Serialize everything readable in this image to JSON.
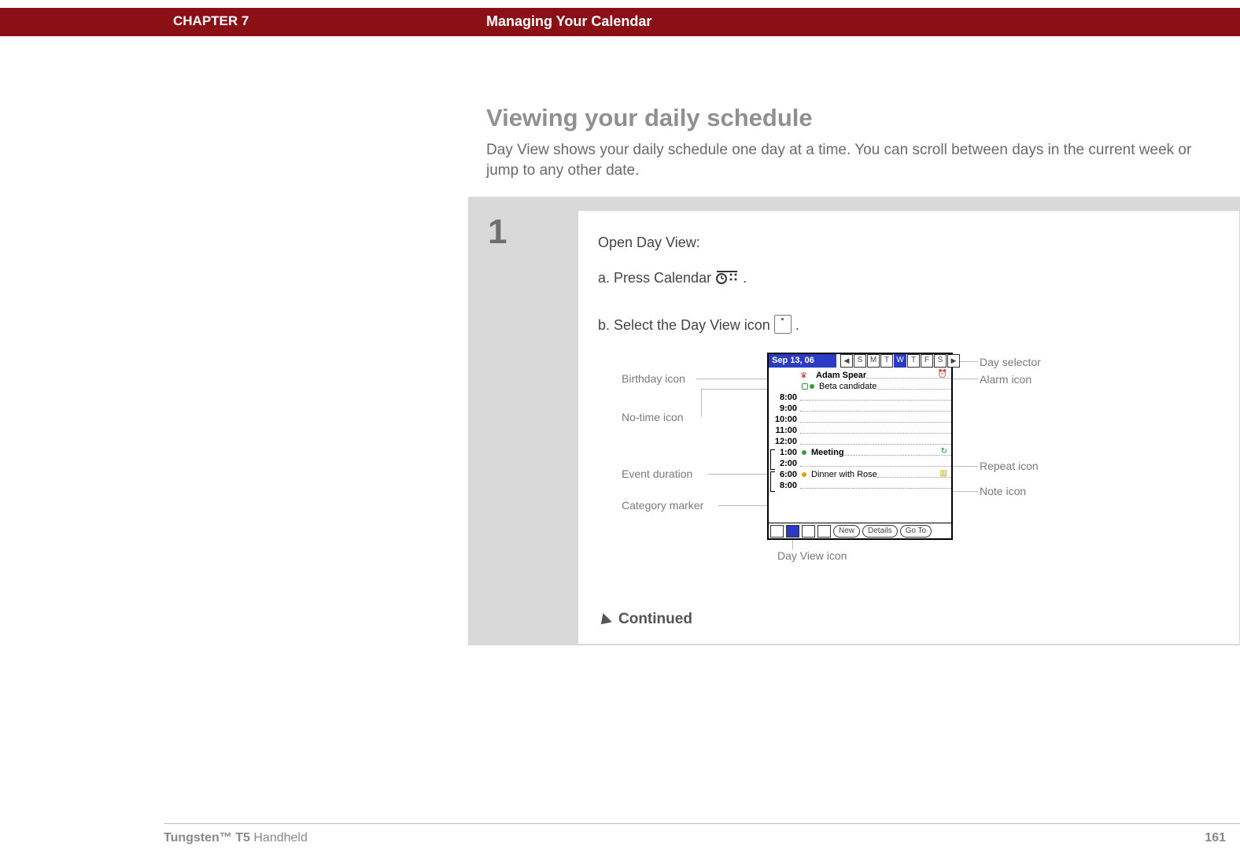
{
  "header": {
    "chapter": "CHAPTER 7",
    "title": "Managing Your Calendar"
  },
  "section": {
    "heading": "Viewing your daily schedule",
    "intro": "Day View shows your daily schedule one day at a time. You can scroll between days in the current week or jump to any other date."
  },
  "step": {
    "number": "1",
    "open_line": "Open Day View:",
    "sub_a_prefix": "a.  Press Calendar ",
    "sub_a_suffix": ".",
    "sub_b_prefix": "b.  Select the Day View icon ",
    "sub_b_suffix": ".",
    "continued": "Continued"
  },
  "callouts": {
    "birthday": "Birthday icon",
    "no_time": "No-time icon",
    "event_duration": "Event duration",
    "category_marker": "Category marker",
    "day_view_icon": "Day View icon",
    "day_selector": "Day selector",
    "alarm_icon": "Alarm icon",
    "repeat_icon": "Repeat icon",
    "note_icon": "Note icon"
  },
  "device": {
    "date": "Sep 13, 06",
    "days": [
      "S",
      "M",
      "T",
      "W",
      "T",
      "F",
      "S"
    ],
    "active_day_index": 3,
    "rows": {
      "birthday_name": "Adam Spear",
      "no_time_event": "Beta candidate",
      "meeting": "Meeting",
      "dinner": "Dinner with Rose",
      "times": [
        "8:00",
        "9:00",
        "10:00",
        "11:00",
        "12:00",
        "1:00",
        "2:00",
        "6:00",
        "8:00"
      ]
    },
    "footer_buttons": {
      "new": "New",
      "details": "Details",
      "goto": "Go To"
    }
  },
  "footer": {
    "product_bold": "Tungsten™ T5",
    "product_rest": " Handheld",
    "page": "161"
  }
}
